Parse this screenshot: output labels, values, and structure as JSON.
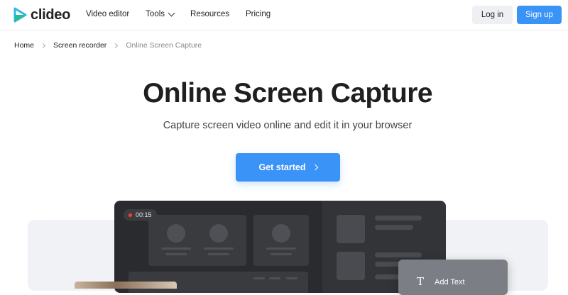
{
  "brand": {
    "name": "clideo",
    "accent": "#3a93f7"
  },
  "nav": {
    "video_editor": "Video editor",
    "tools": "Tools",
    "resources": "Resources",
    "pricing": "Pricing"
  },
  "auth": {
    "login": "Log in",
    "signup": "Sign up"
  },
  "breadcrumb": {
    "home": "Home",
    "screen_recorder": "Screen recorder",
    "current": "Online Screen Capture"
  },
  "hero": {
    "title": "Online Screen Capture",
    "subtitle": "Capture screen video online and edit it in your browser",
    "cta": "Get started"
  },
  "preview": {
    "timer": "00:15",
    "add_text": "Add Text",
    "add_text_icon": "T"
  },
  "icons": [
    "play-logo-icon",
    "chevron-down-icon",
    "chevron-right-icon",
    "record-dot-icon",
    "text-icon"
  ]
}
